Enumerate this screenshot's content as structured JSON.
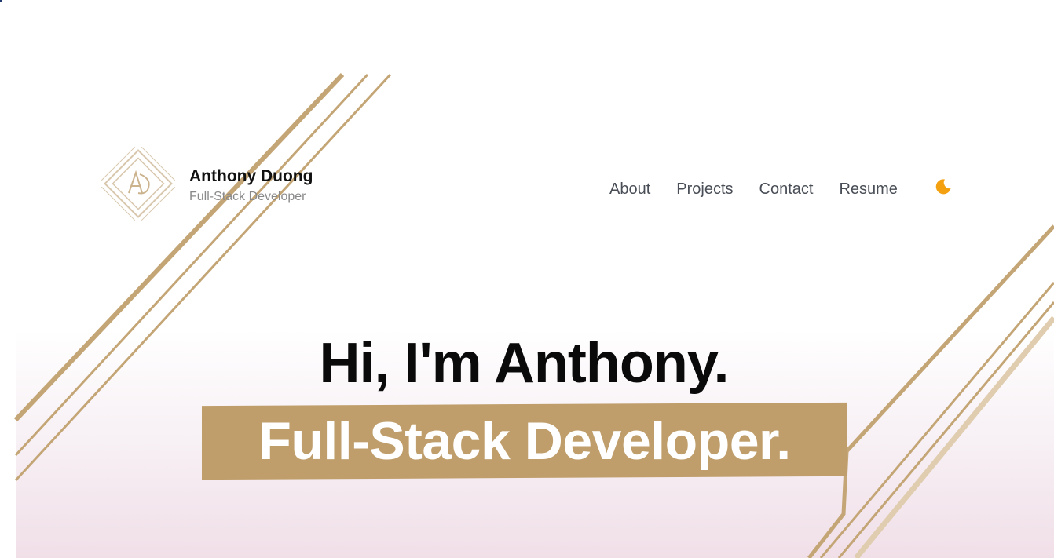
{
  "colors": {
    "accent": "#bf9e6b",
    "line_gold": "#c4a575",
    "moon": "#f4a111",
    "text_dark": "#0a0a0a",
    "nav_text": "#4a4f57"
  },
  "header": {
    "logo_icon": "ad-monogram-logo",
    "logo_initials": "AD",
    "brand_name": "Anthony Duong",
    "brand_role": "Full-Stack Developer"
  },
  "nav": {
    "items": [
      {
        "label": "About"
      },
      {
        "label": "Projects"
      },
      {
        "label": "Contact"
      },
      {
        "label": "Resume"
      }
    ],
    "theme_toggle_icon": "moon-icon"
  },
  "hero": {
    "greeting": "Hi, I'm Anthony.",
    "subtitle": "Full-Stack Developer."
  }
}
